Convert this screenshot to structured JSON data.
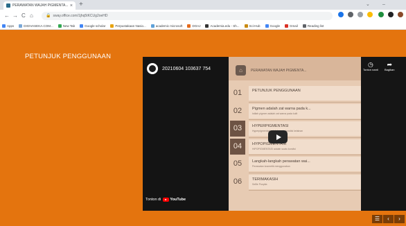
{
  "browser": {
    "tab_title": "PERAWATAN WAJAH PIGMENTA...",
    "tab_close": "×",
    "new_tab": "+",
    "window_controls": [
      "⌄",
      "–"
    ],
    "back": "←",
    "forward": "→",
    "reload": "C",
    "home": "⌂",
    "url": "sway.office.com/1jhq5tKCUg2oeHD",
    "bookmarks": [
      {
        "label": "Apps",
        "color": "#4285f4"
      },
      {
        "label": "DIGIVASEKA.COM...",
        "color": "#7aa7d6"
      },
      {
        "label": "New Tab",
        "color": "#34a853"
      },
      {
        "label": "Google scholar",
        "color": "#4285f4"
      },
      {
        "label": "Perpustakaan Nasio...",
        "color": "#e7a310"
      },
      {
        "label": "academic microsoft",
        "color": "#5fa1d8"
      },
      {
        "label": "DOAJ",
        "color": "#e46a1c"
      },
      {
        "label": "Academia.edu - Sh...",
        "color": "#333333"
      },
      {
        "label": "Sci-Hub",
        "color": "#c98a10"
      },
      {
        "label": "Google",
        "color": "#4285f4"
      },
      {
        "label": "Gmail",
        "color": "#d93025"
      },
      {
        "label": "Reading list",
        "color": "#5f6368"
      }
    ]
  },
  "page": {
    "heading": "PETUNJUK PENGGUNAAN"
  },
  "video": {
    "title": "20210604 103637 754",
    "watch_later": "Tonton nanti",
    "share": "Bagikan",
    "watch_on": "Tonton di",
    "youtube": "YouTube",
    "slide_title": "PERAWATAN WAJAH PIGMENTA...",
    "rows": [
      {
        "num": "01",
        "title": "PETUNJUK PENGGUNAAN",
        "sub": ""
      },
      {
        "num": "02",
        "title": "Pigmen adalah zat warna pada k...",
        "sub": "Istilah pigmen adalah zat warna pada kulit"
      },
      {
        "num": "03",
        "title": "HYPERPIGMENTASI",
        "sub": "Hyperpigmentasi adalah suatu kondisi kelainan"
      },
      {
        "num": "04",
        "title": "HYPOPIGMENTASI",
        "sub": "HIPOPIGMENTASI adalah suatu kondisi"
      },
      {
        "num": "05",
        "title": "Langkah-langkah perawatan wai...",
        "sub": "Perawatan kosmetik menggunakan"
      },
      {
        "num": "06",
        "title": "TERIMAKASIH",
        "sub": "Selfie Puspita"
      }
    ]
  },
  "nav": {
    "menu": "☰",
    "prev": "‹",
    "next": "›"
  }
}
